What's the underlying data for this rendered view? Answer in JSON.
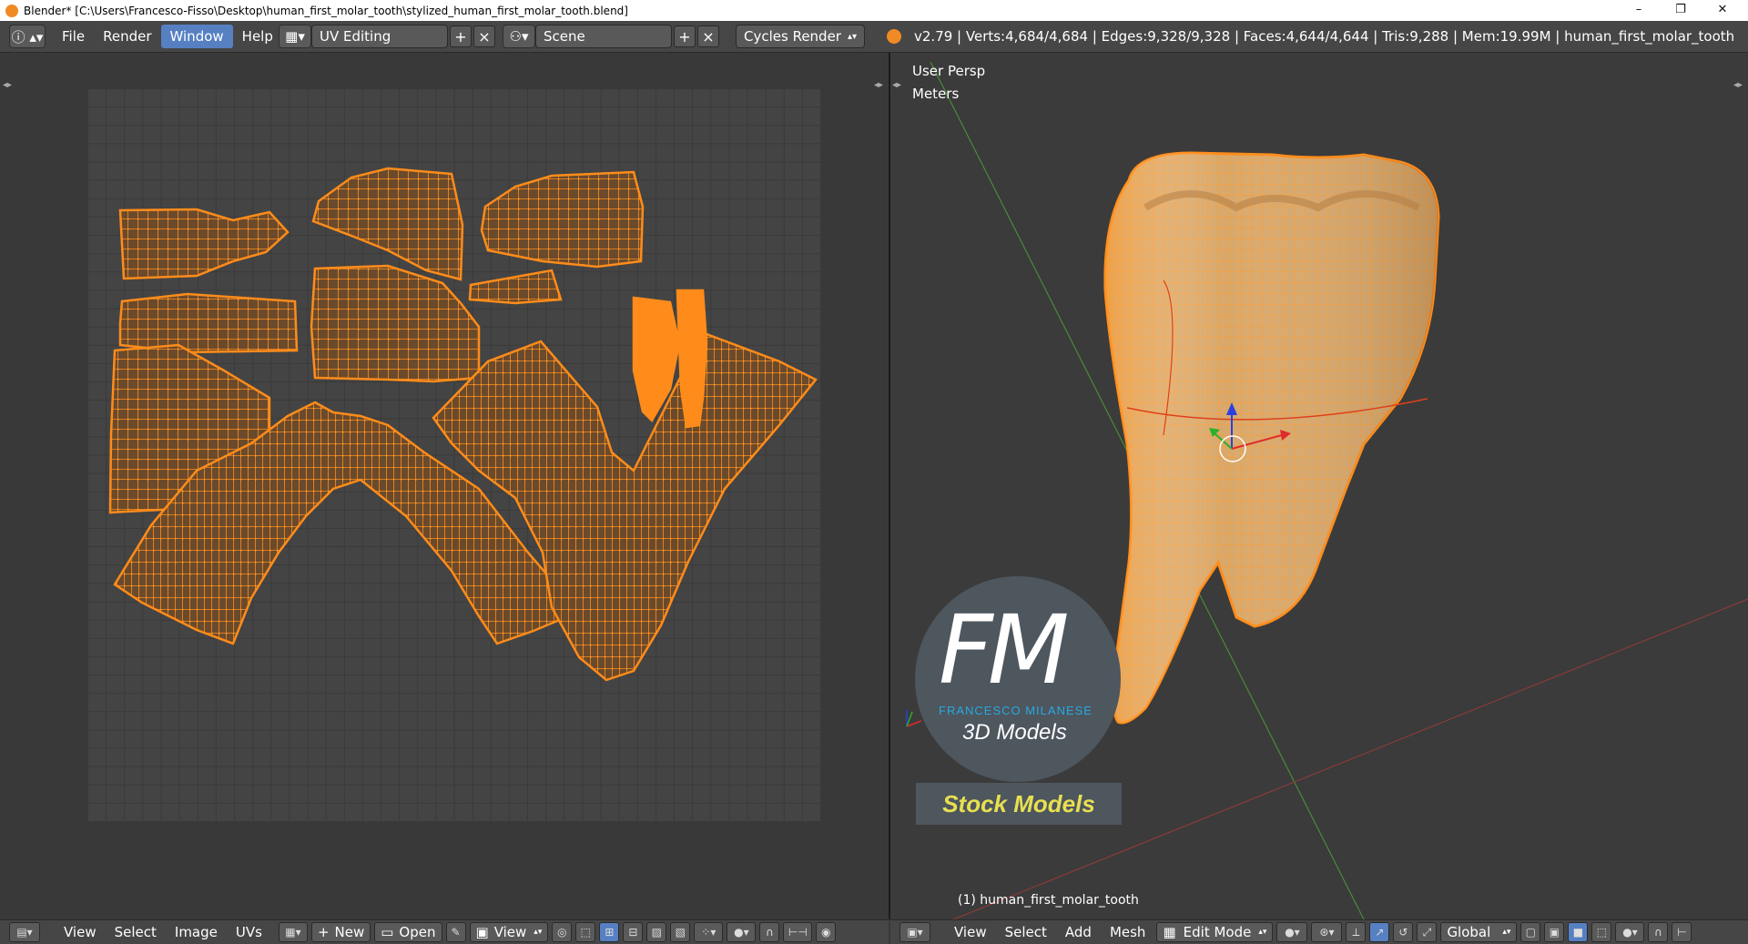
{
  "window": {
    "title": "Blender* [C:\\Users\\Francesco-Fisso\\Desktop\\human_first_molar_tooth\\stylized_human_first_molar_tooth.blend]",
    "minimize": "–",
    "maximize": "❐",
    "close": "✕"
  },
  "header": {
    "menus": [
      "File",
      "Render",
      "Window",
      "Help"
    ],
    "active_menu": "Window",
    "screen_layout": "UV Editing",
    "scene": "Scene",
    "render_engine": "Cycles Render",
    "stats": "v2.79 | Verts:4,684/4,684 | Edges:9,328/9,328 | Faces:4,644/4,644 | Tris:9,288 | Mem:19.99M | human_first_molar_tooth"
  },
  "viewport": {
    "view_name": "User Persp",
    "units": "Meters",
    "object_label": "(1) human_first_molar_tooth",
    "watermark": {
      "initials": "FM",
      "name": "FRANCESCO MILANESE",
      "subtitle": "3D Models",
      "badge": "Stock Models"
    }
  },
  "uv_footer": {
    "menus": [
      "View",
      "Select",
      "Image",
      "UVs"
    ],
    "new_label": "New",
    "open_label": "Open",
    "view_label": "View"
  },
  "view3d_footer": {
    "menus": [
      "View",
      "Select",
      "Add",
      "Mesh"
    ],
    "mode": "Edit Mode",
    "orientation": "Global"
  },
  "colors": {
    "accent": "#5680c2",
    "uv_orange": "#ff8c1a",
    "mesh_orange": "#f2a24a",
    "seam_red": "#e0401a"
  }
}
